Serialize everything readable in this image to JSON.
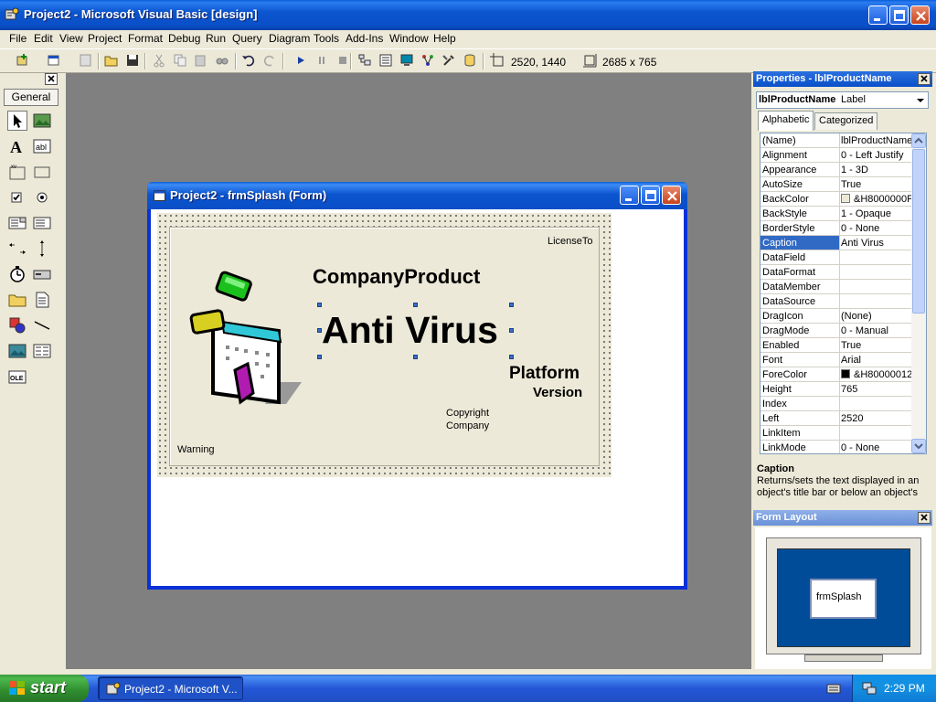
{
  "app": {
    "title": "Project2 - Microsoft Visual Basic [design]"
  },
  "menu": [
    "File",
    "Edit",
    "View",
    "Project",
    "Format",
    "Debug",
    "Run",
    "Query",
    "Diagram",
    "Tools",
    "Add-Ins",
    "Window",
    "Help"
  ],
  "toolbar": {
    "position": "2520, 1440",
    "size": "2685 x 765"
  },
  "toolbox": {
    "tab_label": "General",
    "tools": [
      "pointer-icon",
      "picturebox-icon",
      "label-icon",
      "textbox-icon",
      "frame-icon",
      "commandbutton-icon",
      "checkbox-icon",
      "optionbutton-icon",
      "combobox-icon",
      "listbox-icon",
      "hscrollbar-icon",
      "vscrollbar-icon",
      "timer-icon",
      "drivelist-icon",
      "dirlist-icon",
      "filelist-icon",
      "shape-icon",
      "line-icon",
      "image-icon",
      "data-icon",
      "ole-icon"
    ]
  },
  "form_window": {
    "title": "Project2 - frmSplash (Form)",
    "splash": {
      "license_to": "LicenseTo",
      "company_product": "CompanyProduct",
      "product_name": "Anti Virus",
      "platform": "Platform",
      "version": "Version",
      "copyright": "Copyright",
      "company": "Company",
      "warning": "Warning"
    }
  },
  "properties": {
    "title": "Properties - lblProductName",
    "object_name": "lblProductName",
    "object_type": "Label",
    "tab_alphabetic": "Alphabetic",
    "tab_categorized": "Categorized",
    "rows": [
      {
        "name": "(Name)",
        "value": "lblProductName"
      },
      {
        "name": "Alignment",
        "value": "0 - Left Justify"
      },
      {
        "name": "Appearance",
        "value": "1 - 3D"
      },
      {
        "name": "AutoSize",
        "value": "True"
      },
      {
        "name": "BackColor",
        "value": "&H8000000F"
      },
      {
        "name": "BackStyle",
        "value": "1 - Opaque"
      },
      {
        "name": "BorderStyle",
        "value": "0 - None"
      },
      {
        "name": "Caption",
        "value": "Anti Virus"
      },
      {
        "name": "DataField",
        "value": ""
      },
      {
        "name": "DataFormat",
        "value": ""
      },
      {
        "name": "DataMember",
        "value": ""
      },
      {
        "name": "DataSource",
        "value": ""
      },
      {
        "name": "DragIcon",
        "value": "(None)"
      },
      {
        "name": "DragMode",
        "value": "0 - Manual"
      },
      {
        "name": "Enabled",
        "value": "True"
      },
      {
        "name": "Font",
        "value": "Arial"
      },
      {
        "name": "ForeColor",
        "value": "&H80000012"
      },
      {
        "name": "Height",
        "value": "765"
      },
      {
        "name": "Index",
        "value": ""
      },
      {
        "name": "Left",
        "value": "2520"
      },
      {
        "name": "LinkItem",
        "value": ""
      },
      {
        "name": "LinkMode",
        "value": "0 - None"
      }
    ],
    "desc_title": "Caption",
    "desc_text": "Returns/sets the text displayed in an object's title bar or below an object's"
  },
  "form_layout": {
    "title": "Form Layout",
    "form_label": "frmSplash"
  },
  "taskbar": {
    "start": "start",
    "task": "Project2 - Microsoft V...",
    "clock": "2:29 PM"
  },
  "colors": {
    "xp_blue": "#0a4fc8",
    "selection": "#316ac5",
    "workspace": "#808080",
    "start_green": "#3c9a3c"
  }
}
